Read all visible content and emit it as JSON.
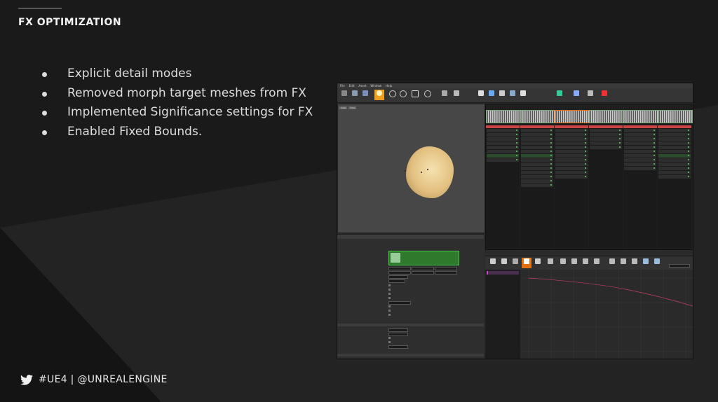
{
  "slide": {
    "title": "FX OPTIMIZATION",
    "bullets": [
      "Explicit detail modes",
      "Removed morph target meshes from FX",
      "Implemented Significance settings for FX",
      "Enabled Fixed Bounds."
    ],
    "footer_text": "#UE4 | @UNREALENGINE",
    "footer_icon": "twitter-bird-icon"
  },
  "editor": {
    "menu": [
      "File",
      "Edit",
      "Asset",
      "Window",
      "Help"
    ],
    "viewport_tabs": [
      "View",
      "Time"
    ],
    "accent": "#f0a020"
  },
  "colors": {
    "background": "#1c1c1c",
    "text": "#dcdcdc",
    "title": "#f2f2f2"
  }
}
